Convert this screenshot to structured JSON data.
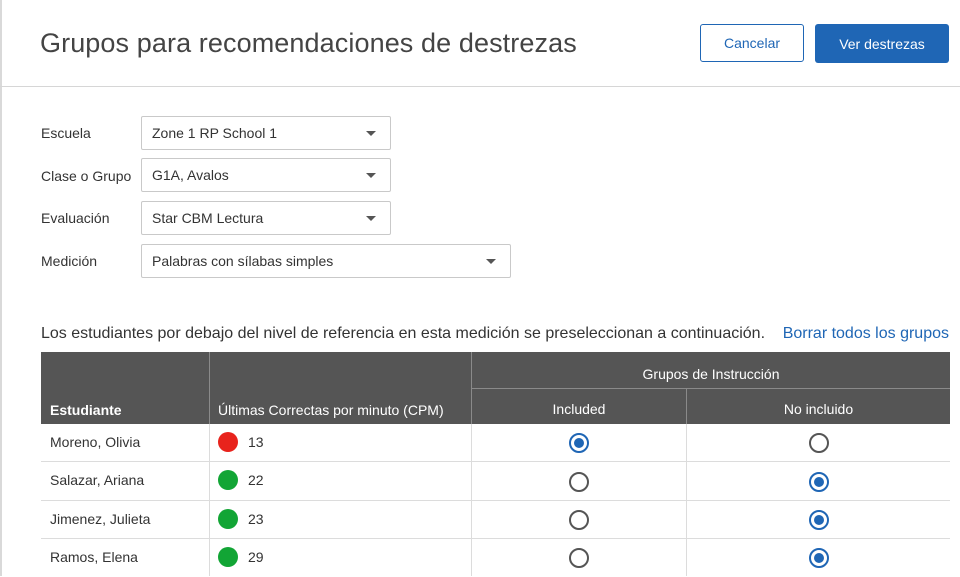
{
  "header": {
    "title": "Grupos para recomendaciones de destrezas",
    "cancel_label": "Cancelar",
    "submit_label": "Ver destrezas"
  },
  "filters": {
    "school": {
      "label": "Escuela",
      "value": "Zone 1 RP School 1"
    },
    "class_group": {
      "label": "Clase o Grupo",
      "value": "G1A, Avalos"
    },
    "assessment": {
      "label": "Evaluación",
      "value": "Star CBM Lectura"
    },
    "measure": {
      "label": "Medición",
      "value": "Palabras con sílabas simples"
    }
  },
  "info": {
    "text": "Los estudiantes por debajo del nivel de referencia en esta medición se preseleccionan a continuación.",
    "clear_link": "Borrar todos los grupos"
  },
  "table": {
    "col_student": "Estudiante",
    "col_score": "Últimas Correctas por minuto (CPM)",
    "group_header": "Grupos de Instrucción",
    "col_included": "Included",
    "col_not_included": "No incluido",
    "rows": [
      {
        "name": "Moreno, Olivia",
        "score": "13",
        "status_color": "#e8231c",
        "included": true
      },
      {
        "name": "Salazar, Ariana",
        "score": "22",
        "status_color": "#12a535",
        "included": false
      },
      {
        "name": "Jimenez, Julieta",
        "score": "23",
        "status_color": "#12a535",
        "included": false
      },
      {
        "name": "Ramos, Elena",
        "score": "29",
        "status_color": "#12a535",
        "included": false
      }
    ]
  },
  "colors": {
    "primary": "#1f66b5",
    "header_bg": "#555555",
    "status_red": "#e8231c",
    "status_green": "#12a535"
  }
}
